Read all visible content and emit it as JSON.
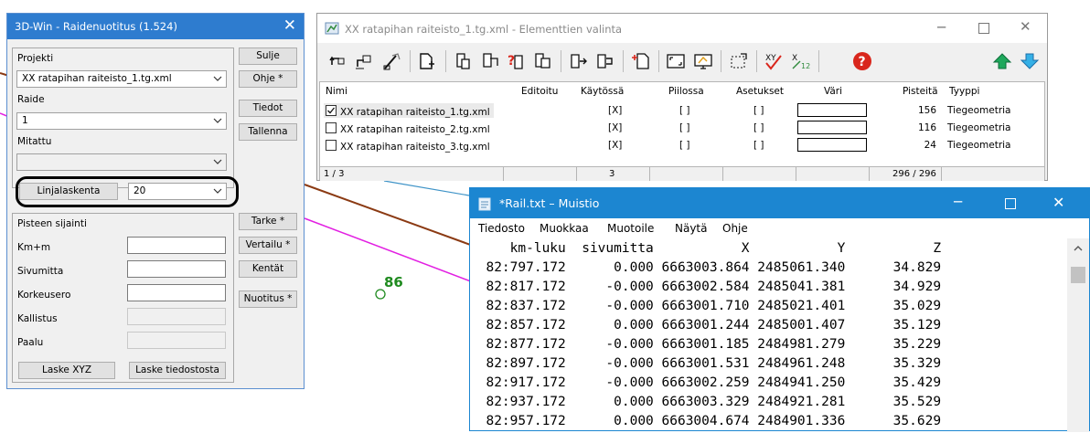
{
  "map": {
    "label": "86"
  },
  "raidenuotitus": {
    "title": "3D-Win - Raidenuotitus  (1.524)",
    "projekti_label": "Projekti",
    "projekti_value": "XX ratapihan raiteisto_1.tg.xml",
    "raide_label": "Raide",
    "raide_value": "1",
    "mitattu_label": "Mitattu",
    "mitattu_value": "",
    "linjalaskenta_button": "Linjalaskenta",
    "linjalaskenta_value": "20",
    "pisteen_sijainti_label": "Pisteen sijainti",
    "kmm_label": "Km+m",
    "sivumitta_label": "Sivumitta",
    "korkeusero_label": "Korkeusero",
    "kallistus_label": "Kallistus",
    "paalu_label": "Paalu",
    "laske_xyz_button": "Laske XYZ",
    "laske_tiedostosta_button": "Laske tiedostosta",
    "sulje_button": "Sulje",
    "ohje_button": "Ohje *",
    "tiedot_button": "Tiedot",
    "tallenna_button": "Tallenna",
    "tarke_button": "Tarke *",
    "vertailu_button": "Vertailu *",
    "kentat_button": "Kentät",
    "nuotitus_button": "Nuotitus *"
  },
  "elementit": {
    "title": "XX ratapihan raiteisto_1.tg.xml - Elementtien valinta",
    "columns": [
      "Nimi",
      "Editoitu",
      "Käytössä",
      "Piilossa",
      "Asetukset",
      "Väri",
      "Pisteitä",
      "Tyyppi"
    ],
    "rows": [
      {
        "checked": true,
        "name": "XX ratapihan raiteisto_1.tg.xml",
        "kaytossa": "[X]",
        "piilossa": "[ ]",
        "asetukset": "[ ]",
        "pisteita": "156",
        "tyyppi": "Tiegeometria"
      },
      {
        "checked": false,
        "name": "XX ratapihan raiteisto_2.tg.xml",
        "kaytossa": "[X]",
        "piilossa": "[ ]",
        "asetukset": "[ ]",
        "pisteita": "116",
        "tyyppi": "Tiegeometria"
      },
      {
        "checked": false,
        "name": "XX ratapihan raiteisto_3.tg.xml",
        "kaytossa": "[X]",
        "piilossa": "[ ]",
        "asetukset": "[ ]",
        "pisteita": "24",
        "tyyppi": "Tiegeometria"
      }
    ],
    "status": {
      "rows": "1 / 3",
      "kaytossa": "3",
      "pisteita": "296 / 296"
    },
    "colors": {
      "title_text": "#8a8a8a",
      "help": "#d9261c",
      "arrow_up": "#1fa85c",
      "arrow_down": "#2b8fd6"
    }
  },
  "muistio": {
    "title": "*Rail.txt – Muistio",
    "menu": [
      "Tiedosto",
      "Muokkaa",
      "Muotoile",
      "Näytä",
      "Ohje"
    ],
    "lines": [
      "     km-luku  sivumitta           X           Y           Z",
      "  82:797.172      0.000 6663003.864 2485061.340      34.829",
      "  82:817.172     -0.000 6663002.584 2485041.381      34.929",
      "  82:837.172     -0.000 6663001.710 2485021.401      35.029",
      "  82:857.172      0.000 6663001.244 2485001.407      35.129",
      "  82:877.172     -0.000 6663001.185 2484981.279      35.229",
      "  82:897.172     -0.000 6663001.531 2484961.248      35.329",
      "  82:917.172     -0.000 6663002.259 2484941.250      35.429",
      "  82:937.172      0.000 6663003.329 2484921.281      35.529",
      "  82:957.172      0.000 6663004.674 2484901.336      35.629"
    ]
  }
}
